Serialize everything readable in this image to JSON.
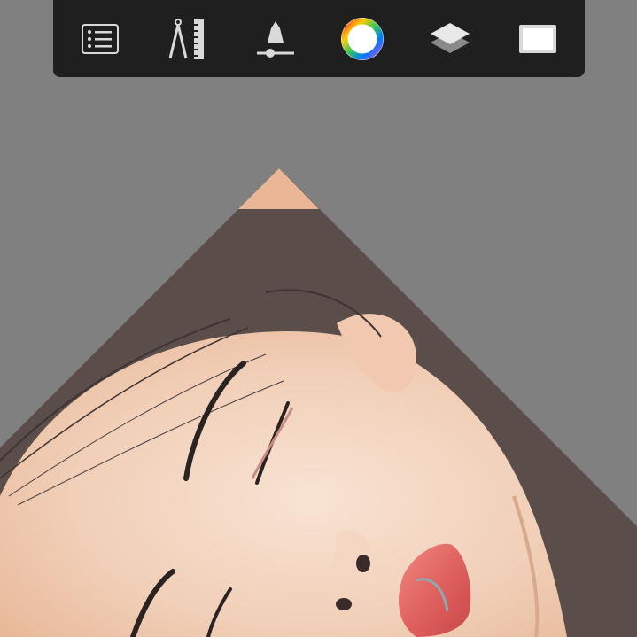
{
  "toolbar": {
    "tools": [
      {
        "id": "menu",
        "icon": "list-menu-icon"
      },
      {
        "id": "guides",
        "icon": "compass-ruler-icon"
      },
      {
        "id": "brush",
        "icon": "brush-size-icon"
      },
      {
        "id": "color",
        "icon": "color-wheel-icon"
      },
      {
        "id": "layers",
        "icon": "layers-icon"
      },
      {
        "id": "canvas",
        "icon": "canvas-frame-icon"
      }
    ]
  },
  "colors": {
    "background": "#808080",
    "toolbar": "#1f1f1f",
    "icon": "#d9d9d9",
    "skin": "#f2d2bd",
    "hair": "#5a4d4a",
    "lips": "#e0625e"
  }
}
